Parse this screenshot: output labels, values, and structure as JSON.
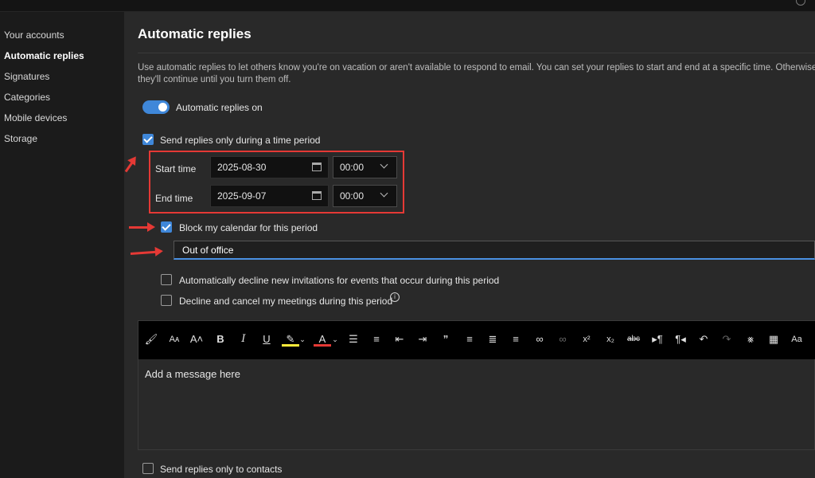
{
  "sidebar": {
    "items": [
      {
        "label": "Your accounts",
        "active": false
      },
      {
        "label": "Automatic replies",
        "active": true
      },
      {
        "label": "Signatures",
        "active": false
      },
      {
        "label": "Categories",
        "active": false
      },
      {
        "label": "Mobile devices",
        "active": false
      },
      {
        "label": "Storage",
        "active": false
      }
    ]
  },
  "main": {
    "title": "Automatic replies",
    "description_line1": "Use automatic replies to let others know you're on vacation or aren't available to respond to email. You can set your replies to start and end at a specific time. Otherwise,",
    "description_line2": "they'll continue until you turn them off.",
    "toggle": {
      "label": "Automatic replies on",
      "on": true
    },
    "time_period": {
      "label": "Send replies only during a time period",
      "checked": true
    },
    "start": {
      "label": "Start time",
      "date": "2025-08-30",
      "time": "00:00"
    },
    "end": {
      "label": "End time",
      "date": "2025-09-07",
      "time": "00:00"
    },
    "block_calendar": {
      "label": "Block my calendar for this period",
      "checked": true
    },
    "event_title": {
      "value": "Out of office"
    },
    "decline_new": {
      "label": "Automatically decline new invitations for events that occur during this period",
      "checked": false
    },
    "decline_cancel": {
      "label": "Decline and cancel my meetings during this period",
      "checked": false
    },
    "editor": {
      "placeholder": "Add a message here"
    },
    "contacts_only": {
      "label": "Send replies only to contacts",
      "checked": false
    }
  },
  "colors": {
    "accent": "#3f87d9",
    "annotation": "#e53935",
    "panel": "#292929",
    "toolbar": "#000000"
  },
  "toolbar_icons": [
    "format-painter-icon",
    "font-size-icon",
    "font-grow-icon",
    "bold-icon",
    "italic-icon",
    "underline-icon",
    "highlight-icon",
    "font-color-icon",
    "bullets-icon",
    "numbering-icon",
    "decrease-indent-icon",
    "increase-indent-icon",
    "quote-icon",
    "align-left-icon",
    "align-center-icon",
    "align-right-icon",
    "link-icon",
    "unlink-icon",
    "superscript-icon",
    "subscript-icon",
    "strikethrough-icon",
    "ltr-icon",
    "rtl-icon",
    "undo-icon",
    "redo-icon",
    "clear-format-icon",
    "table-icon",
    "change-case-icon"
  ]
}
